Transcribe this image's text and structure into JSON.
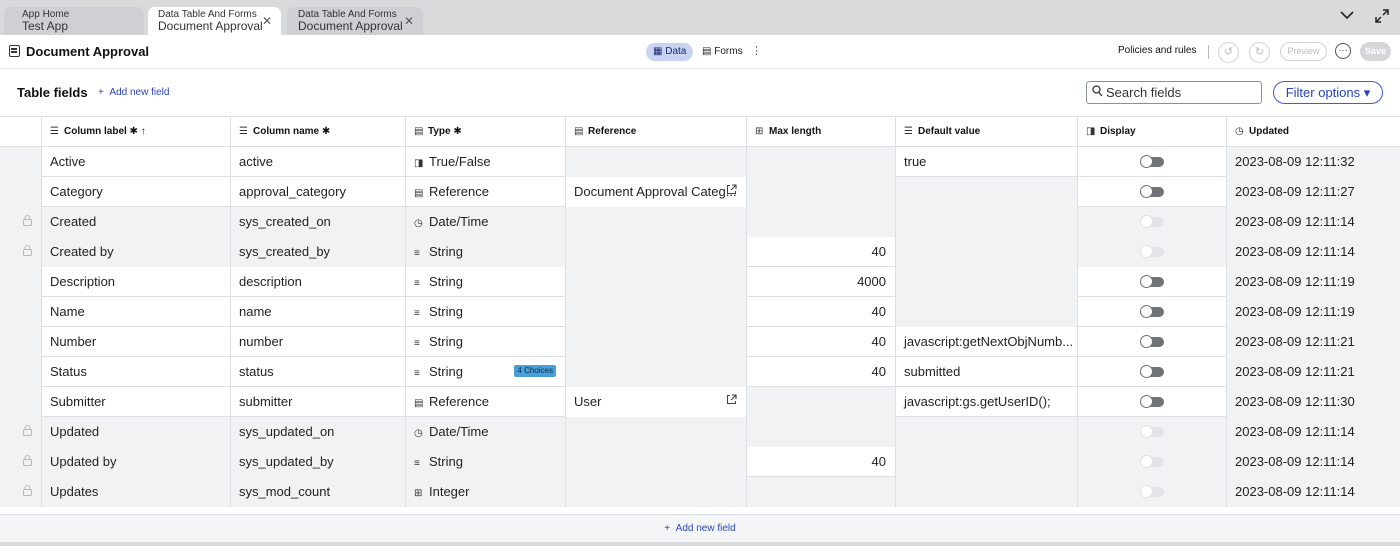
{
  "tabs": [
    {
      "line1": "App Home",
      "line2": "Test App"
    },
    {
      "line1": "Data Table And Forms",
      "line2": "Document Approval",
      "close": "✕"
    },
    {
      "line1": "Data Table And Forms",
      "line2": "Document Approval",
      "close": "✕"
    }
  ],
  "header": {
    "title": "Document Approval",
    "data_tab": "Data",
    "forms_tab": "Forms",
    "more": "⋮",
    "policies": "Policies and rules",
    "preview": "Preview",
    "save": "Save"
  },
  "toolbar": {
    "title": "Table fields",
    "add_field": "Add new field",
    "search_placeholder": "Search fields",
    "filter": "Filter options ▾"
  },
  "columns": {
    "label": "Column label ✱ ↑",
    "name": "Column name ✱",
    "type": "Type ✱",
    "reference": "Reference",
    "max_length": "Max length",
    "default": "Default value",
    "display": "Display",
    "updated": "Updated"
  },
  "rows": [
    {
      "label": "Active",
      "name": "active",
      "type": "True/False",
      "type_icon": "◨",
      "reference": "",
      "max": "",
      "default": "true",
      "display": "off",
      "updated": "2023-08-09 12:11:32",
      "locked": false
    },
    {
      "label": "Category",
      "name": "approval_category",
      "type": "Reference",
      "type_icon": "▤",
      "reference": "Document Approval Categ...",
      "max": "",
      "default": "",
      "display": "off",
      "updated": "2023-08-09 12:11:27",
      "locked": false
    },
    {
      "label": "Created",
      "name": "sys_created_on",
      "type": "Date/Time",
      "type_icon": "◷",
      "reference": "",
      "max": "",
      "default": "",
      "display": "disabled",
      "updated": "2023-08-09 12:11:14",
      "locked": true
    },
    {
      "label": "Created by",
      "name": "sys_created_by",
      "type": "String",
      "type_icon": "≡",
      "reference": "",
      "max": "40",
      "default": "",
      "display": "disabled",
      "updated": "2023-08-09 12:11:14",
      "locked": true
    },
    {
      "label": "Description",
      "name": "description",
      "type": "String",
      "type_icon": "≡",
      "reference": "",
      "max": "4000",
      "default": "",
      "display": "off",
      "updated": "2023-08-09 12:11:19",
      "locked": false
    },
    {
      "label": "Name",
      "name": "name",
      "type": "String",
      "type_icon": "≡",
      "reference": "",
      "max": "40",
      "default": "",
      "display": "off",
      "updated": "2023-08-09 12:11:19",
      "locked": false
    },
    {
      "label": "Number",
      "name": "number",
      "type": "String",
      "type_icon": "≡",
      "reference": "",
      "max": "40",
      "default": "javascript:getNextObjNumb...",
      "display": "off",
      "updated": "2023-08-09 12:11:21",
      "locked": false
    },
    {
      "label": "Status",
      "name": "status",
      "type": "String",
      "type_icon": "≡",
      "badge": "4 Choices",
      "reference": "",
      "max": "40",
      "default": "submitted",
      "display": "off",
      "updated": "2023-08-09 12:11:21",
      "locked": false
    },
    {
      "label": "Submitter",
      "name": "submitter",
      "type": "Reference",
      "type_icon": "▤",
      "reference": "User",
      "max": "",
      "default": "javascript:gs.getUserID();",
      "display": "off",
      "updated": "2023-08-09 12:11:30",
      "locked": false
    },
    {
      "label": "Updated",
      "name": "sys_updated_on",
      "type": "Date/Time",
      "type_icon": "◷",
      "reference": "",
      "max": "",
      "default": "",
      "display": "disabled",
      "updated": "2023-08-09 12:11:14",
      "locked": true
    },
    {
      "label": "Updated by",
      "name": "sys_updated_by",
      "type": "String",
      "type_icon": "≡",
      "reference": "",
      "max": "40",
      "default": "",
      "display": "disabled",
      "updated": "2023-08-09 12:11:14",
      "locked": true
    },
    {
      "label": "Updates",
      "name": "sys_mod_count",
      "type": "Integer",
      "type_icon": "⊞",
      "reference": "",
      "max": "",
      "default": "",
      "display": "disabled",
      "updated": "2023-08-09 12:11:14",
      "locked": true
    }
  ],
  "footer": {
    "add_field": "Add new field"
  }
}
